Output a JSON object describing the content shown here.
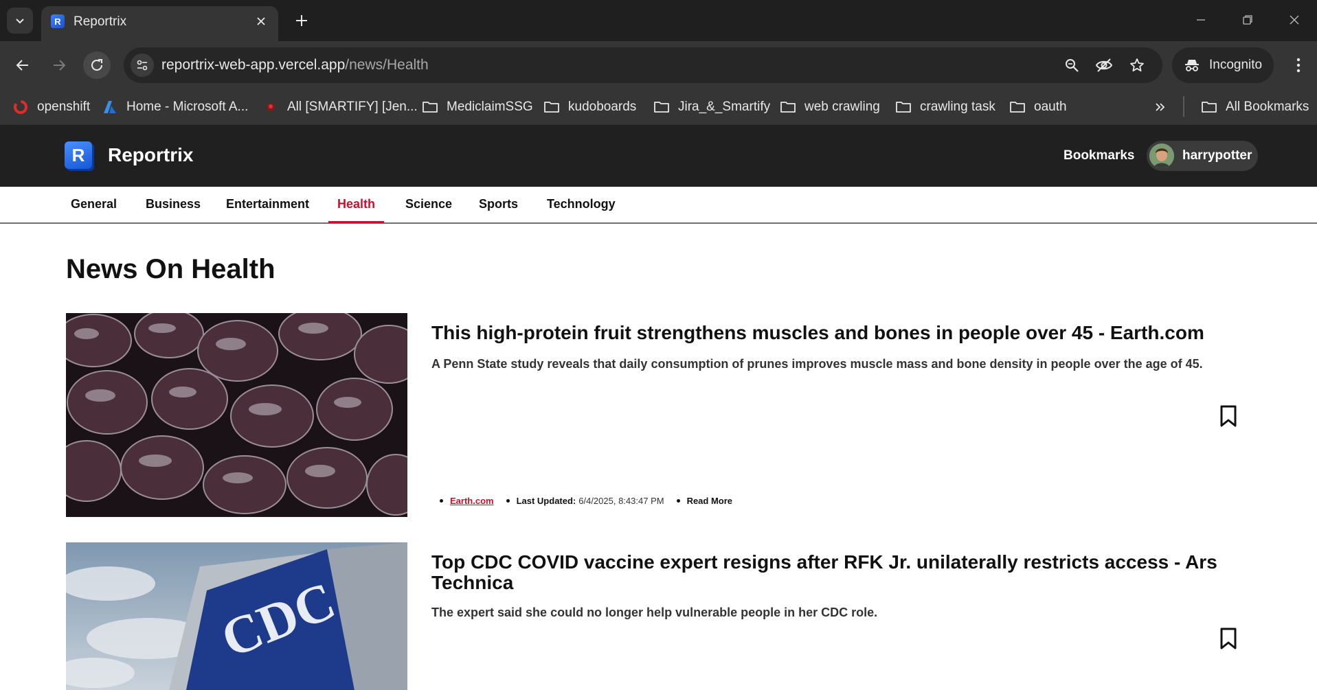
{
  "browser": {
    "tab_title": "Reportrix",
    "url_domain": "reportrix-web-app.vercel.app",
    "url_path": "/news/Health",
    "incognito_label": "Incognito",
    "bookmarks": [
      {
        "label": "openshift",
        "icon": "openshift-icon"
      },
      {
        "label": "Home - Microsoft A...",
        "icon": "azure-icon"
      },
      {
        "label": "All [SMARTIFY] [Jen...",
        "icon": "jenkins-icon"
      },
      {
        "label": "MediclaimSSG",
        "icon": "folder-icon"
      },
      {
        "label": "kudoboards",
        "icon": "folder-icon"
      },
      {
        "label": "Jira_&_Smartify",
        "icon": "folder-icon"
      },
      {
        "label": "web crawling",
        "icon": "folder-icon"
      },
      {
        "label": "crawling task",
        "icon": "folder-icon"
      },
      {
        "label": "oauth",
        "icon": "folder-icon"
      }
    ],
    "all_bookmarks_label": "All Bookmarks"
  },
  "site": {
    "logo_letter": "R",
    "name": "Reportrix",
    "bookmarks_link": "Bookmarks",
    "username": "harrypotter",
    "accent_color": "#c8102e"
  },
  "categories": [
    "General",
    "Business",
    "Entertainment",
    "Health",
    "Science",
    "Sports",
    "Technology"
  ],
  "active_category": "Health",
  "page_title": "News On Health",
  "articles": [
    {
      "title": "This high-protein fruit strengthens muscles and bones in people over 45 - Earth.com",
      "description": "A Penn State study reveals that daily consumption of prunes improves muscle mass and bone density in people over the age of 45.",
      "source": "Earth.com",
      "last_updated_label": "Last Updated:",
      "last_updated": "6/4/2025, 8:43:47 PM",
      "read_more": "Read More",
      "image": "prunes-photo"
    },
    {
      "title": "Top CDC COVID vaccine expert resigns after RFK Jr. unilaterally restricts access - Ars Technica",
      "description": "The expert said she could no longer help vulnerable people in her CDC role.",
      "image": "cdc-building-photo",
      "image_text": "CDC"
    }
  ]
}
